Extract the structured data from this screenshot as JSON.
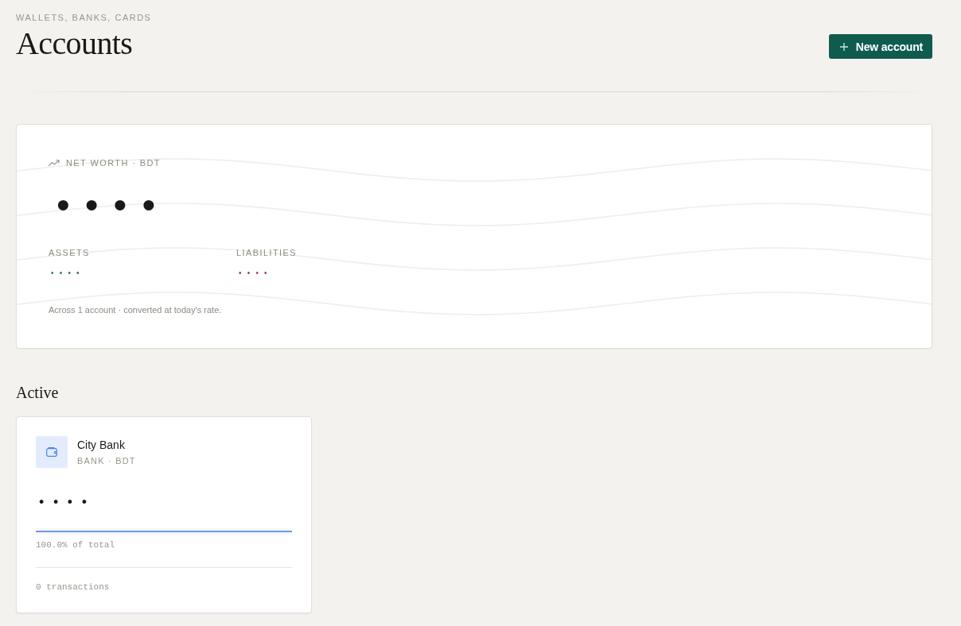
{
  "header": {
    "eyebrow": "WALLETS, BANKS, CARDS",
    "title": "Accounts",
    "new_button": "New account"
  },
  "net_worth": {
    "label": "NET WORTH · BDT",
    "value": "••••",
    "figures": [
      {
        "label": "ASSETS",
        "value": "••••",
        "color": "#2f6b4f"
      },
      {
        "label": "LIABILITIES",
        "value": "••••",
        "color": "#a3303b"
      }
    ],
    "note": "Across 1 account · converted at today's rate."
  },
  "sections": [
    {
      "title": "Active",
      "accounts": [
        {
          "name": "City Bank",
          "meta": "BANK · BDT",
          "balance": "••••",
          "level": 1,
          "share": "100.0% of total",
          "transactions": "0 transactions"
        }
      ]
    }
  ]
}
